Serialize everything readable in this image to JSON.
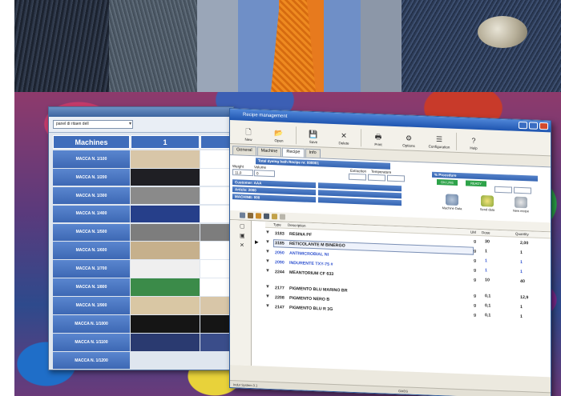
{
  "machines_window": {
    "selector_value": "panel di ritaen dell",
    "headers": {
      "machines": "Machines",
      "col1": "1",
      "col2": ""
    },
    "machines": [
      "MACCA N. 1/100",
      "MACCA N. 1/200",
      "MACCA N. 1/300",
      "MACCA N. 1/400",
      "MACCA N. 1/500",
      "MACCA N. 1/600",
      "MACCA N. 1/700",
      "MACCA N. 1/800",
      "MACCA N. 1/900",
      "MACCA N. 1/1000",
      "MACCA N. 1/1100",
      "MACCA N. 1/1200"
    ],
    "swatch_colors": [
      "#d8c6a8",
      "#1f1f24",
      "#8a8a8a",
      "#263f8a",
      "#7d7d7d",
      "#c6b08c",
      "#efefef",
      "#3b8b49",
      "#d9c7a4",
      "#151515",
      "#2a3a70"
    ],
    "swatch2_colors": [
      "#ffffff",
      "#ffffff",
      "#ffffff",
      "#ffffff",
      "#7d7d7d",
      "#ffffff",
      "#ffffff",
      "#ffffff",
      "#d8c6a8",
      "#151515",
      "#3a4d8a"
    ]
  },
  "recipe_window": {
    "title": "Recipe management",
    "toolbar": [
      {
        "label": "New",
        "icon": "new-document-icon",
        "glyph": "🗋"
      },
      {
        "label": "Open",
        "icon": "open-folder-icon",
        "glyph": "📂"
      },
      {
        "label": "Save",
        "icon": "save-disk-icon",
        "glyph": "💾"
      },
      {
        "label": "Delete",
        "icon": "delete-x-icon",
        "glyph": "✕"
      },
      {
        "label": "Print",
        "icon": "print-icon",
        "glyph": "🖶"
      },
      {
        "label": "Options",
        "icon": "options-icon",
        "glyph": "⚙"
      },
      {
        "label": "Configuration",
        "icon": "configuration-icon",
        "glyph": "☰"
      },
      {
        "label": "Help",
        "icon": "help-icon",
        "glyph": "?"
      }
    ],
    "tabs": [
      "General",
      "Machine",
      "Recipe",
      "Info"
    ],
    "form": {
      "band_main": "Total dyeing bath Recipe nr. 000001",
      "label_weight": "Weight",
      "label_volume": "Volume",
      "weight_value": "11,0",
      "volume_value": "0",
      "label_extraction": "Extraction",
      "label_temperature": "Temperature",
      "band_procedure": "% Procedure",
      "status_1": "ON LINE",
      "status_2": "READY",
      "band_customer": "Customer: AAA",
      "band_article": "Article: 2000",
      "band_machine": "MACHINE: 000",
      "band_info1": "",
      "band_info2": "",
      "action_1": "Machine Data",
      "action_2": "Send data",
      "action_3": "New recipe"
    },
    "list_header": {
      "type": "Type",
      "description": "Description",
      "um": "UM",
      "dose": "Dose",
      "quantity": "Quantity"
    },
    "rows": [
      {
        "code": "3183",
        "desc": "RESINA PF",
        "um": "g",
        "qty": "30",
        "qty2": "2,00",
        "style": "normal"
      },
      {
        "code": "3185",
        "desc": "RETICOLANTE M BINERGO",
        "um": "g",
        "qty": "1",
        "qty2": "1",
        "style": "selected"
      },
      {
        "code": "2050",
        "desc": "ANTIMICROBIAL NI",
        "um": "g",
        "qty": "1",
        "qty2": "1",
        "style": "blue"
      },
      {
        "code": "2090",
        "desc": "INDURENTE TXY-75 #",
        "um": "g",
        "qty": "1",
        "qty2": "1",
        "style": "blue"
      },
      {
        "code": "2244",
        "desc": "MEANTORIUM CF 633",
        "um": "g",
        "qty": "10",
        "qty2": "40",
        "style": "normal"
      },
      {
        "code": "2177",
        "desc": "PIGMENTO BLU MARINO BR",
        "um": "g",
        "qty": "0,1",
        "qty2": "12,9",
        "style": "normal"
      },
      {
        "code": "2208",
        "desc": "PIGMENTO NERO B",
        "um": "g",
        "qty": "0,1",
        "qty2": "1",
        "style": "normal"
      },
      {
        "code": "2147",
        "desc": "PIGMENTO BLU R 3G",
        "um": "g",
        "qty": "0,1",
        "qty2": "1",
        "style": "normal"
      }
    ],
    "status_left": "Indur System 3.1",
    "status_mid": "GMDS"
  }
}
